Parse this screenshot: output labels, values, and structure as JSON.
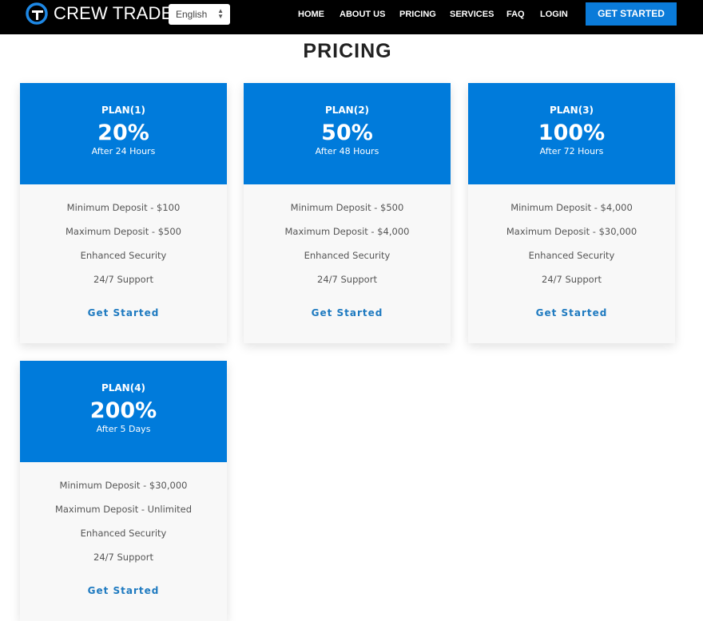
{
  "navbar": {
    "brand": "CREW TRADE",
    "language": "English",
    "links": [
      "HOME",
      "ABOUT US",
      "PRICING",
      "SERVICES",
      "FAQ",
      "LOGIN"
    ],
    "cta": "GET STARTED",
    "accent_color": "#0a7bd9"
  },
  "page": {
    "title": "PRICING"
  },
  "plans": [
    {
      "name": "PLAN(1)",
      "rate": "20%",
      "period": "After 24 Hours",
      "features": [
        "Minimum Deposit - $100",
        "Maximum Deposit - $500",
        "Enhanced Security",
        "24/7 Support"
      ],
      "button": "Get Started"
    },
    {
      "name": "PLAN(2)",
      "rate": "50%",
      "period": "After 48 Hours",
      "features": [
        "Minimum Deposit - $500",
        "Maximum Deposit - $4,000",
        "Enhanced Security",
        "24/7 Support"
      ],
      "button": "Get Started"
    },
    {
      "name": "PLAN(3)",
      "rate": "100%",
      "period": "After 72 Hours",
      "features": [
        "Minimum Deposit - $4,000",
        "Maximum Deposit - $30,000",
        "Enhanced Security",
        "24/7 Support"
      ],
      "button": "Get Started"
    },
    {
      "name": "PLAN(4)",
      "rate": "200%",
      "period": "After 5 Days",
      "features": [
        "Minimum Deposit - $30,000",
        "Maximum Deposit - Unlimited",
        "Enhanced Security",
        "24/7 Support"
      ],
      "button": "Get Started"
    }
  ]
}
